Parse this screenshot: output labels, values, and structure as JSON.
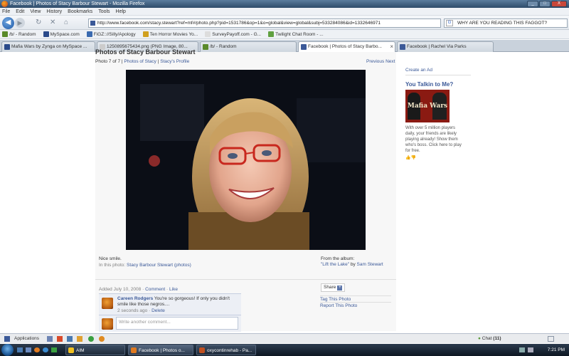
{
  "window": {
    "title": "Facebook | Photos of Stacy Barbour Stewart - Mozilla Firefox",
    "buttons": [
      "_",
      "□",
      "X"
    ]
  },
  "menubar": [
    "File",
    "Edit",
    "View",
    "History",
    "Bookmarks",
    "Tools",
    "Help"
  ],
  "navbar": {
    "url": "http://www.facebook.com/stacy.stewart?ref=mf#/photo.php?pid=1531786&op=1&o=global&view=global&subj=533284086&id=1332646971",
    "search_value": "WHY ARE YOU READING THIS FAGGOT?"
  },
  "bookmarks": [
    {
      "label": "/b/ - Random",
      "icon": "clover-icon",
      "color": "#5a8a2a"
    },
    {
      "label": "MySpace.com",
      "icon": "myspace-icon",
      "color": "#2a4a8a"
    },
    {
      "label": "FiGZ:://Silly/Apology",
      "icon": "figz-icon",
      "color": "#3a6ab0"
    },
    {
      "label": "Ten Horror Movies Yo...",
      "icon": "star-icon",
      "color": "#d0a020"
    },
    {
      "label": "SurveyPayoff.com - G...",
      "icon": "page-icon",
      "color": "#dddddd"
    },
    {
      "label": "Twilight Chat Room - ...",
      "icon": "chat-icon",
      "color": "#60a040"
    }
  ],
  "tabs": [
    {
      "label": "Mafia Wars by Zynga on MySpace ...",
      "color": "#2a4a8a",
      "active": false
    },
    {
      "label": "1250895675434.png (PNG Image, 80...",
      "color": "#cccccc",
      "active": false
    },
    {
      "label": "/b/ - Random",
      "color": "#5a8a2a",
      "active": false
    },
    {
      "label": "Facebook | Photos of Stacy Barbo...",
      "color": "#3b5998",
      "active": true
    },
    {
      "label": "Facebook | Rachel Via Parks",
      "color": "#3b5998",
      "active": false
    }
  ],
  "photo_page": {
    "title": "Photos of Stacy Barbour Stewart",
    "photo_index": "Photo 7 of 7",
    "sep": "|",
    "photos_of_link": "Photos of Stacy",
    "profile_link": "Stacy's Profile",
    "previous": "Previous",
    "next": "Next",
    "caption": "Nice smile.",
    "in_photo_label": "In this photo:",
    "in_photo_name": "Stacy Barbour Stewart",
    "in_photo_link": "(photos)",
    "album_label": "From the album:",
    "album_name": "\"Lift the Lake\"",
    "album_by": "by",
    "album_owner": "Sam Stewart",
    "added": "Added July 10, 2008",
    "comment_link": "Comment",
    "like_link": "Like",
    "share_label": "Share",
    "tag_photo": "Tag This Photo",
    "report_photo": "Report This Photo"
  },
  "comments": [
    {
      "author": "Careen Rodgers",
      "text": "You're so gorgeous! If only you didn't smile like those negros....",
      "time": "2 seconds ago",
      "delete": "Delete"
    }
  ],
  "comment_input": {
    "placeholder": "Write another comment..."
  },
  "ad": {
    "create": "Create an Ad",
    "title": "You Talkin to Me?",
    "logo_text": "Mafia Wars",
    "body": "With over 5 million players daily, your friends are likely playing already! Show them who's boss. Click here to play for free."
  },
  "fb_bar": {
    "applications": "Applications",
    "chat": "Chat",
    "chat_count": "(11)"
  },
  "taskbar": {
    "items": [
      {
        "label": "AIM",
        "color": "#f0c020"
      },
      {
        "label": "Facebook | Photos o...",
        "color": "#e07a20"
      },
      {
        "label": "oxycontinrehab - Pa...",
        "color": "#c05020"
      }
    ],
    "time": "7:21 PM"
  }
}
